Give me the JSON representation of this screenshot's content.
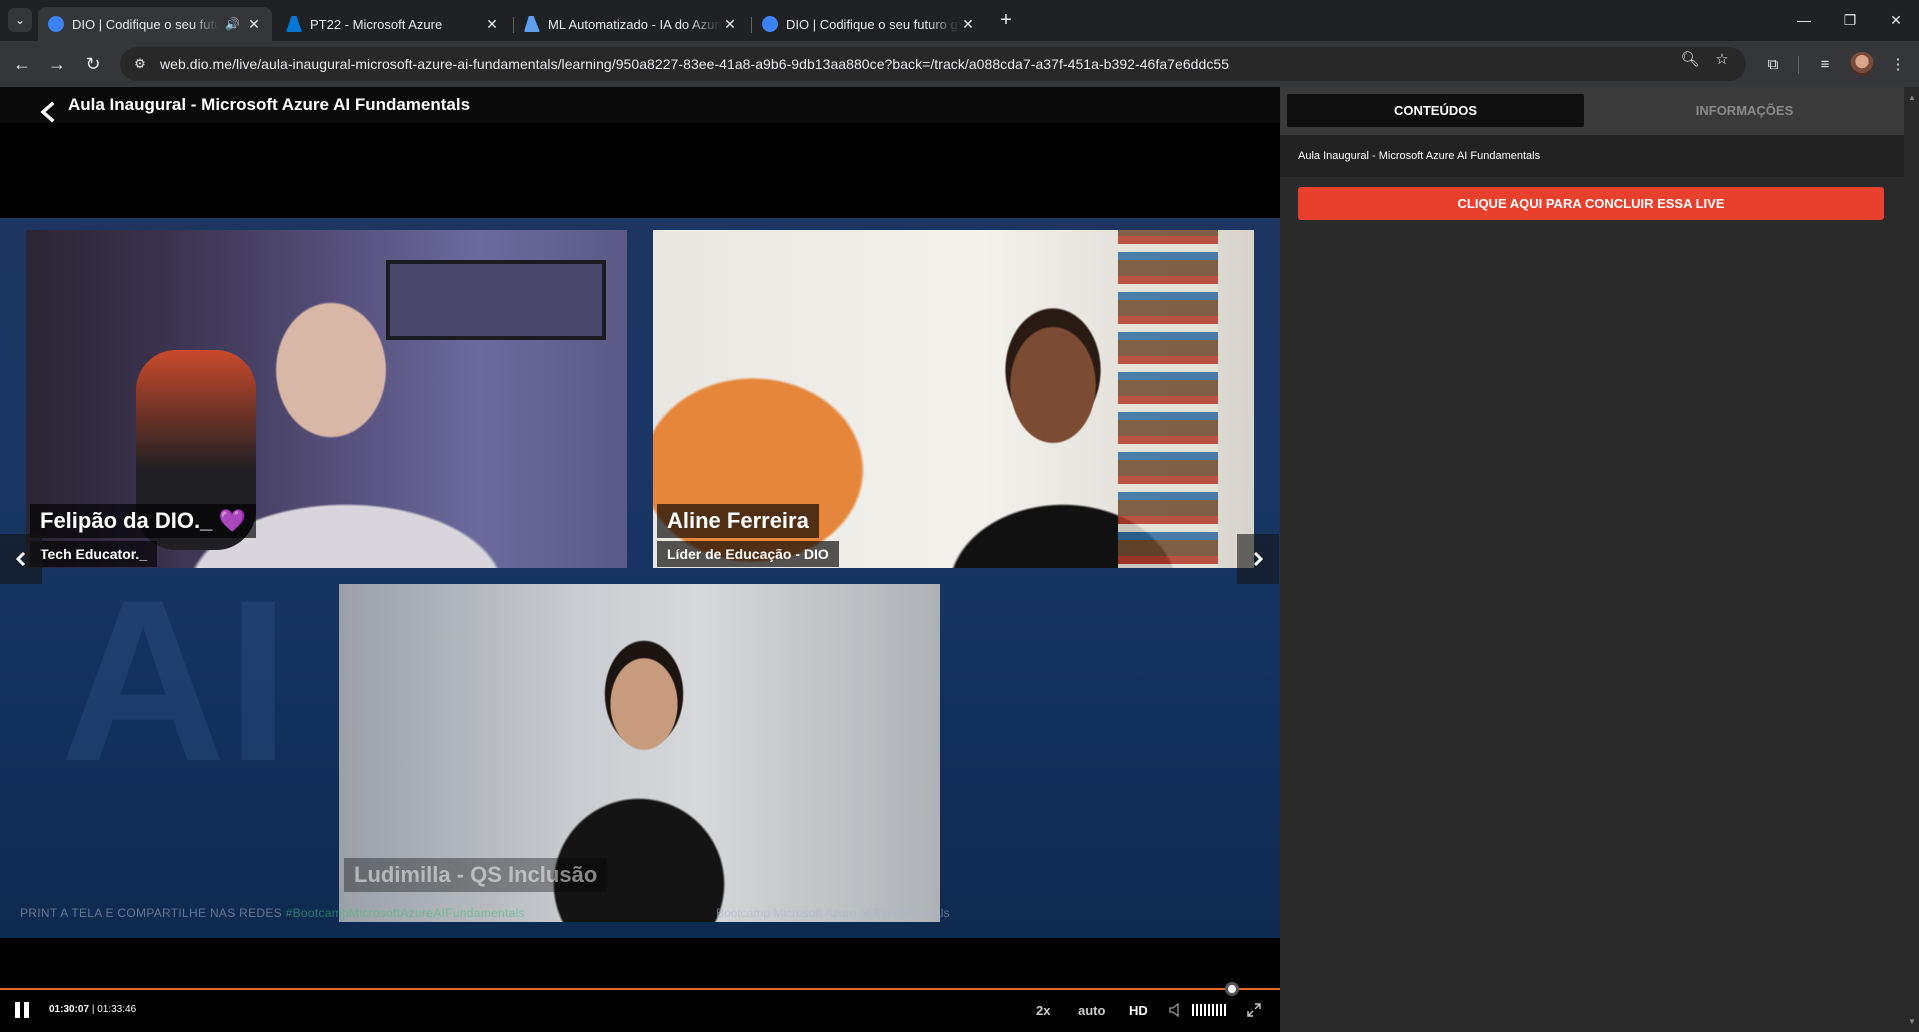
{
  "browser": {
    "tabs": [
      {
        "title": "DIO | Codifique o seu futuro",
        "active": true,
        "icon": "dio-favicon",
        "audio": true
      },
      {
        "title": "PT22 - Microsoft Azure",
        "active": false,
        "icon": "azure-favicon"
      },
      {
        "title": "ML Automatizado - IA do Azure",
        "active": false,
        "icon": "azure-ml-favicon"
      },
      {
        "title": "DIO | Codifique o seu futuro gl",
        "active": false,
        "icon": "dio-favicon"
      }
    ],
    "url": "web.dio.me/live/aula-inaugural-microsoft-azure-ai-fundamentals/learning/950a8227-83ee-41a8-a9b6-9db13aa880ce?back=/track/a088cda7-a37f-451a-b392-46fa7e6ddc55"
  },
  "player": {
    "title": "Aula Inaugural - Microsoft Azure AI Fundamentals",
    "participants": [
      {
        "name": "Felipão da DIO._ 💜",
        "role": "Tech Educator._"
      },
      {
        "name": "Aline Ferreira",
        "role": "Líder de Educação - DIO"
      },
      {
        "name": "Ludimilla - QS Inclusão",
        "role": ""
      }
    ],
    "footer_left": "PRINT A TELA E COMPARTILHE NAS REDES",
    "footer_hashtag": "#BootcampMicrosoftAzureAIFundamentals",
    "footer_right": "Bootcamp Microsoft Azure AI Fundamentals",
    "controls": {
      "current_time": "01:30:07",
      "separator": "|",
      "duration": "01:33:46",
      "speed": "2x",
      "quality_mode": "auto",
      "quality": "HD",
      "progress": 0.96
    }
  },
  "sidebar": {
    "tabs": [
      "CONTEÚDOS",
      "INFORMAÇÕES"
    ],
    "heading": "Aula Inaugural - Microsoft Azure AI Fundamentals",
    "conclude_button": "CLIQUE AQUI PARA CONCLUIR ESSA LIVE"
  },
  "colors": {
    "accent": "#e8402c",
    "progress": "#e8682b",
    "stage_blue": "#1a3766"
  }
}
